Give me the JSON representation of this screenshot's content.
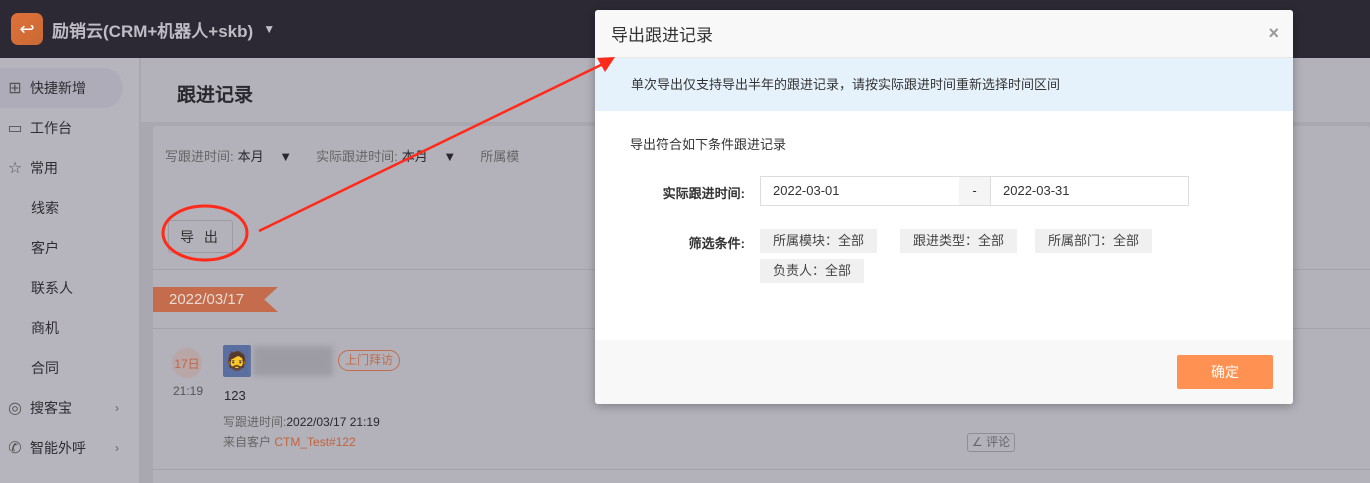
{
  "app": {
    "title": "励销云(CRM+机器人+skb)"
  },
  "sidebar": {
    "items": [
      {
        "label": "快捷新增",
        "icon": "add-box-icon"
      },
      {
        "label": "工作台",
        "icon": "monitor-icon"
      },
      {
        "label": "常用",
        "icon": "star-icon"
      },
      {
        "label": "线索"
      },
      {
        "label": "客户"
      },
      {
        "label": "联系人"
      },
      {
        "label": "商机"
      },
      {
        "label": "合同"
      },
      {
        "label": "搜客宝",
        "icon": "search-globe-icon"
      },
      {
        "label": "智能外呼",
        "icon": "phone-icon"
      }
    ]
  },
  "page": {
    "title": "跟进记录",
    "filters": [
      {
        "label": "写跟进时间:",
        "value": "本月"
      },
      {
        "label": "实际跟进时间:",
        "value": "本月"
      },
      {
        "label": "所属模"
      }
    ],
    "export_label": "导 出",
    "date_tag": "2022/03/17",
    "record": {
      "day": "17日",
      "time": "21:19",
      "type_tag": "上门拜访",
      "content": "123",
      "write_time_label": "写跟进时间:",
      "write_time": "2022/03/17 21:19",
      "from_label": "来自客户",
      "from_customer": "CTM_Test#122",
      "comment_label": "评论"
    }
  },
  "modal": {
    "title": "导出跟进记录",
    "close": "×",
    "info": "单次导出仅支持导出半年的跟进记录，请按实际跟进时间重新选择时间区间",
    "subtitle": "导出符合如下条件跟进记录",
    "date_label": "实际跟进时间:",
    "date_from": "2022-03-01",
    "date_sep": "-",
    "date_to": "2022-03-31",
    "filter_label": "筛选条件:",
    "chips": [
      "所属模块：全部",
      "跟进类型：全部",
      "所属部门：全部",
      "负责人：全部"
    ],
    "ok_label": "确定"
  },
  "colors": {
    "accent": "#ff9153",
    "annotation": "#ff2a1a",
    "info_bg": "#e6f2fb"
  }
}
